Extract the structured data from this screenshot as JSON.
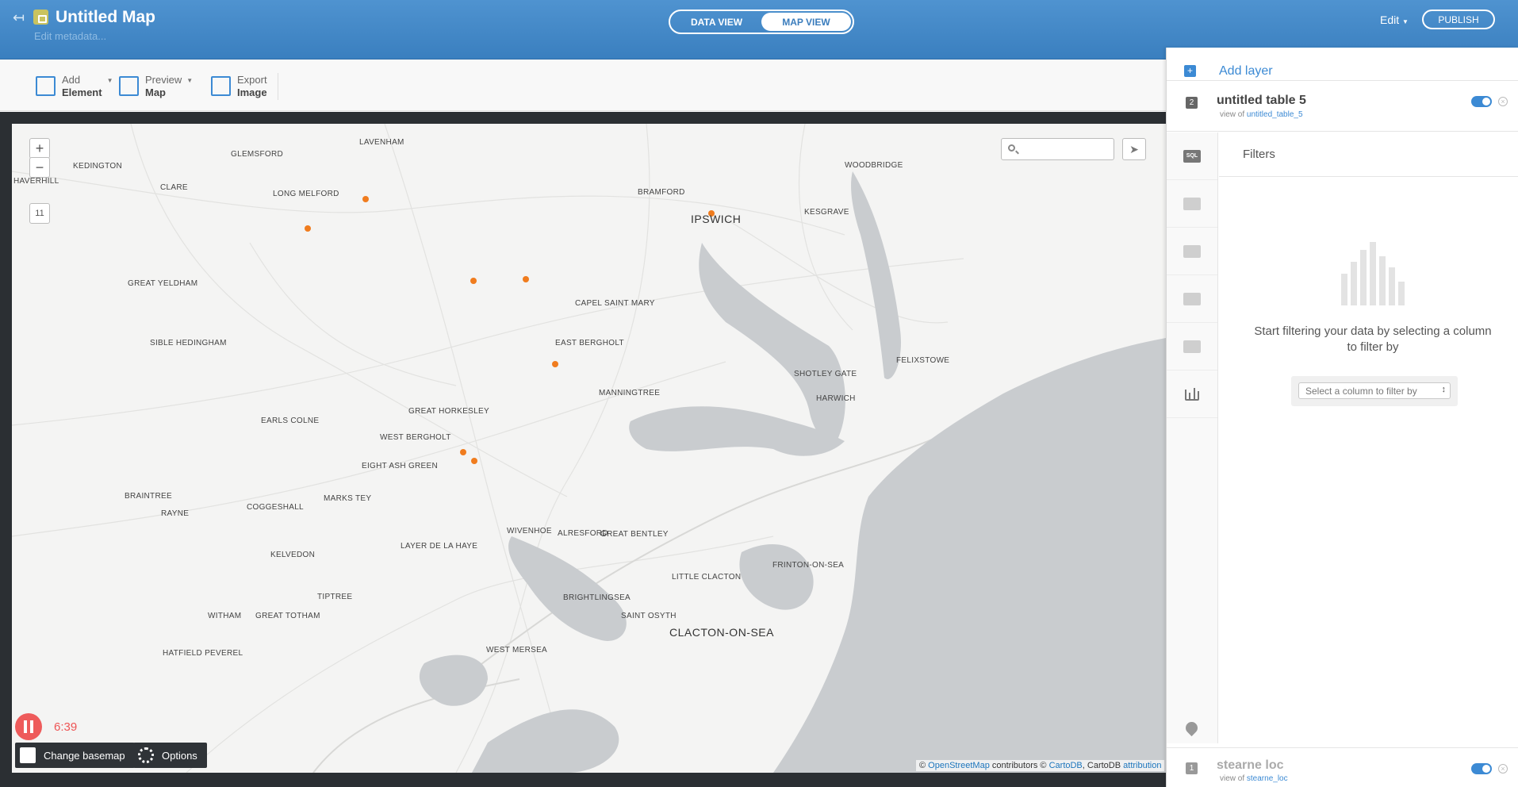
{
  "header": {
    "title": "Untitled Map",
    "edit_metadata": "Edit metadata...",
    "view_tabs": [
      "DATA VIEW",
      "MAP VIEW"
    ],
    "active_tab": "MAP VIEW",
    "edit_label": "Edit",
    "publish_label": "PUBLISH"
  },
  "toolbar": {
    "add_element": [
      "Add",
      "Element"
    ],
    "preview_map": [
      "Preview",
      "Map"
    ],
    "export_image": [
      "Export",
      "Image"
    ]
  },
  "map": {
    "zoom_in": "+",
    "zoom_out": "−",
    "zoom_level": "11",
    "search_placeholder": "",
    "places": [
      "LAVENHAM",
      "GLEMSFORD",
      "KEDINGTON",
      "HAVERHILL",
      "CLARE",
      "LONG MELFORD",
      "GREAT YELDHAM",
      "SIBLE HEDINGHAM",
      "EARLS COLNE",
      "GREAT HORKESLEY",
      "WEST BERGHOLT",
      "EIGHT ASH GREEN",
      "BRAINTREE",
      "RAYNE",
      "COGGESHALL",
      "MARKS TEY",
      "KELVEDON",
      "LAYER DE LA HAYE",
      "TIPTREE",
      "WITHAM",
      "GREAT TOTHAM",
      "HATFIELD PEVEREL",
      "WEST MERSEA",
      "WIVENHOE",
      "ALRESFORD",
      "GREAT BENTLEY",
      "BRIGHTLINGSEA",
      "SAINT OSYTH",
      "LITTLE CLACTON",
      "CLACTON-ON-SEA",
      "FRINTON-ON-SEA",
      "MANNINGTREE",
      "EAST BERGHOLT",
      "CAPEL SAINT MARY",
      "BRAMFORD",
      "IPSWICH",
      "KESGRAVE",
      "WOODBRIDGE",
      "SHOTLEY GATE",
      "HARWICH",
      "FELIXSTOWE"
    ],
    "recording_time": "6:39",
    "change_basemap": "Change basemap",
    "options": "Options",
    "attribution": {
      "prefix": "©",
      "osm": "OpenStreetMap",
      "mid": "contributors ©",
      "carto": "CartoDB",
      "sep": ", CartoDB",
      "attr": "attribution"
    },
    "point_color": "#f07c1e"
  },
  "panel": {
    "add_layer": "Add layer",
    "layer": {
      "number": "2",
      "name": "untitled table 5",
      "view_of": "view of",
      "table": "untitled_table_5"
    },
    "nav": [
      "SQL",
      "wizard",
      "infowindow",
      "CSS",
      "legend",
      "filters"
    ],
    "filters_title": "Filters",
    "filters_message": "Start filtering your data by selecting a column to filter by",
    "select_placeholder": "Select a column to filter by",
    "bottom_layer": {
      "number": "1",
      "name": "stearne loc",
      "view_of": "view of",
      "table": "stearne_loc"
    }
  }
}
